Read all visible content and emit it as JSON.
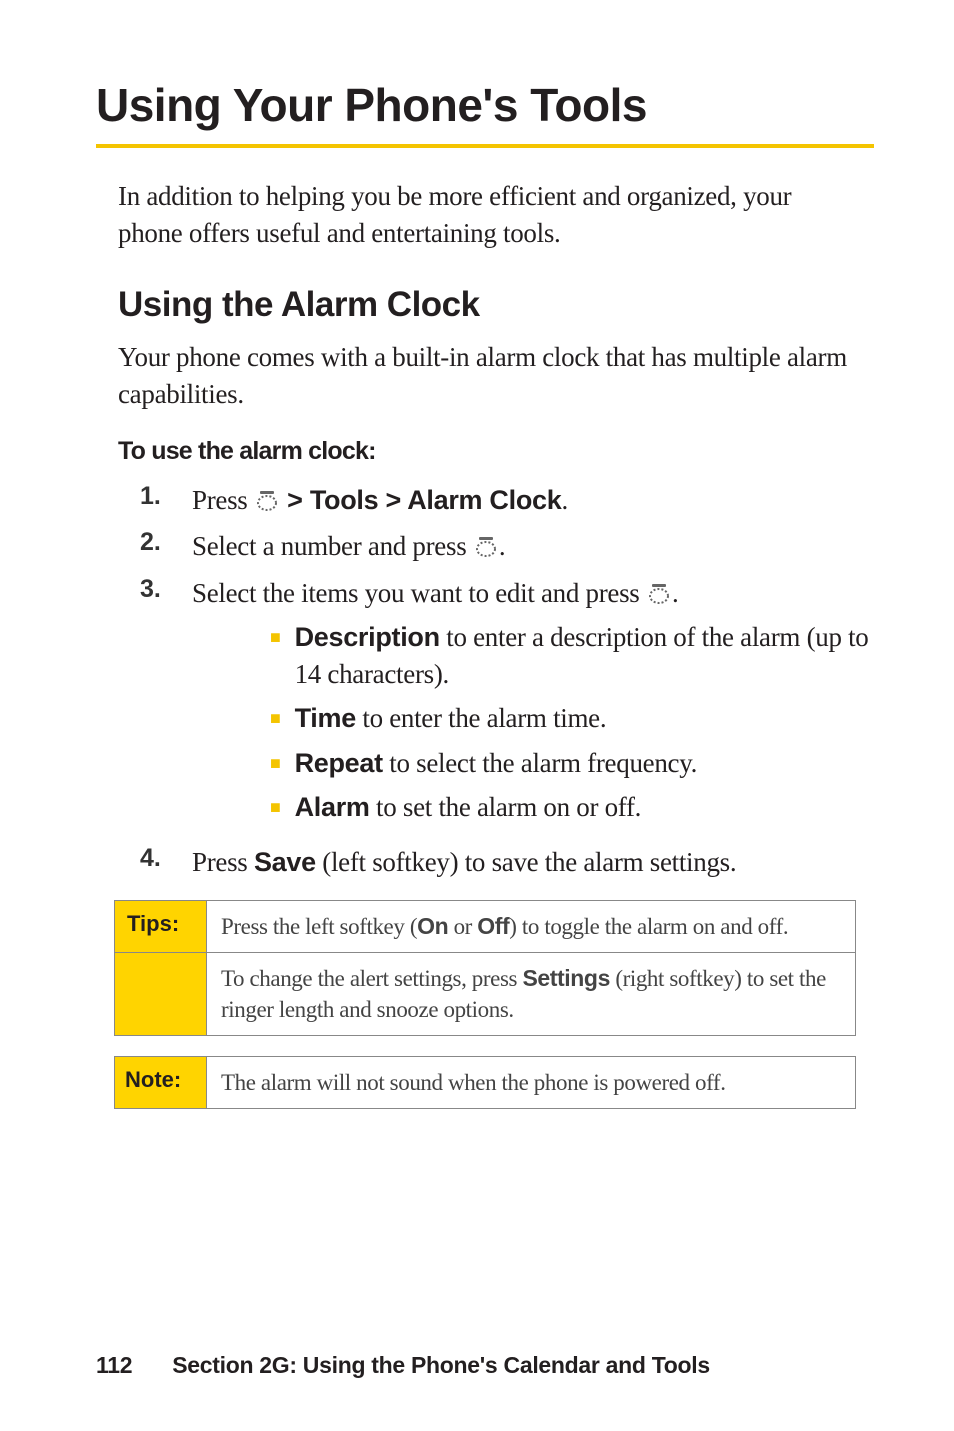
{
  "h1": "Using Your Phone's Tools",
  "intro": "In addition to helping you be more efficient and organized, your phone offers useful and entertaining tools.",
  "h2": "Using the Alarm Clock",
  "para2": "Your phone comes with a built-in alarm clock that has multiple alarm capabilities.",
  "subhead": "To use the alarm clock:",
  "steps": {
    "s1": {
      "num": "1.",
      "a": "Press ",
      "b": " > Tools  > Alarm Clock",
      "c": "."
    },
    "s2": {
      "num": "2.",
      "a": "Select a number and press ",
      "b": "."
    },
    "s3": {
      "num": "3.",
      "a": "Select the items you want to edit and press ",
      "b": "."
    },
    "s4": {
      "num": "4.",
      "a": "Press ",
      "b": "Save",
      "c": " (left softkey) to save the alarm settings."
    }
  },
  "bullets": {
    "b1": {
      "a": "Description",
      "b": " to enter a description of the alarm (up to 14 characters)."
    },
    "b2": {
      "a": "Time",
      "b": " to enter the alarm time."
    },
    "b3": {
      "a": "Repeat",
      "b": " to select the alarm frequency."
    },
    "b4": {
      "a": "Alarm",
      "b": " to set the alarm on or off."
    }
  },
  "tips": {
    "label": "Tips:",
    "r1a": "Press the left softkey (",
    "r1b": "On",
    "r1c": " or ",
    "r1d": "Off",
    "r1e": ") to toggle the alarm on and off.",
    "r2a": "To change the alert settings, press ",
    "r2b": "Settings",
    "r2c": " (right softkey) to set the ringer length and snooze options."
  },
  "note": {
    "label": "Note:",
    "text": "The alarm will not sound when the phone is powered off."
  },
  "footer": {
    "page": "112",
    "section": "Section 2G: Using the Phone's Calendar and Tools"
  }
}
